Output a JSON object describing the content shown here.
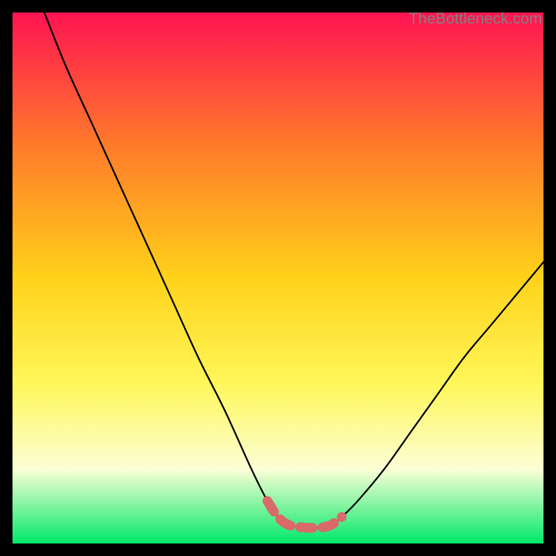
{
  "attribution": "TheBottleneck.com",
  "colors": {
    "bg": "#000000",
    "grad_top": "#ff1452",
    "grad_mid_upper": "#ff7a2a",
    "grad_mid": "#ffd21a",
    "grad_mid_lower": "#fff75a",
    "grad_low_cream": "#fcffd6",
    "grad_green": "#00e86b",
    "curve": "#000000",
    "marker": "#d96a69"
  },
  "chart_data": {
    "type": "line",
    "title": "",
    "xlabel": "",
    "ylabel": "",
    "xlim": [
      0,
      100
    ],
    "ylim": [
      0,
      100
    ],
    "series": [
      {
        "name": "bottleneck-curve",
        "x": [
          6,
          10,
          15,
          20,
          25,
          30,
          35,
          40,
          45,
          48,
          50,
          52,
          55,
          58,
          60,
          62,
          65,
          70,
          75,
          80,
          85,
          90,
          95,
          100
        ],
        "y": [
          100,
          90,
          79,
          68,
          57,
          46,
          35,
          25,
          14,
          8,
          5,
          3.5,
          3,
          3,
          3.5,
          5,
          8,
          14,
          21,
          28,
          35,
          41,
          47,
          53
        ]
      },
      {
        "name": "optimal-range-marker",
        "x": [
          48,
          50,
          52,
          55,
          58,
          60,
          62
        ],
        "y": [
          8,
          5,
          3.5,
          3,
          3,
          3.5,
          5
        ]
      }
    ]
  }
}
